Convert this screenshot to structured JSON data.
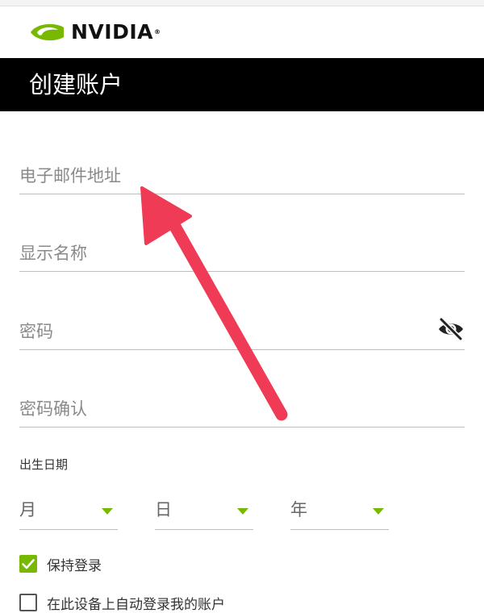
{
  "brand": {
    "name": "NVIDIA",
    "mark": "®",
    "accent": "#76b900"
  },
  "header": {
    "title": "创建账户"
  },
  "form": {
    "email_label": "电子邮件地址",
    "display_name_label": "显示名称",
    "password_label": "密码",
    "password_confirm_label": "密码确认",
    "dob": {
      "label": "出生日期",
      "month": "月",
      "day": "日",
      "year": "年"
    },
    "keep_signed_in": {
      "label": "保持登录",
      "checked": true
    },
    "auto_login": {
      "label": "在此设备上自动登录我的账户",
      "checked": false
    }
  },
  "annotation": {
    "arrow_color": "#ef3b55",
    "icon": "arrow-icon"
  }
}
